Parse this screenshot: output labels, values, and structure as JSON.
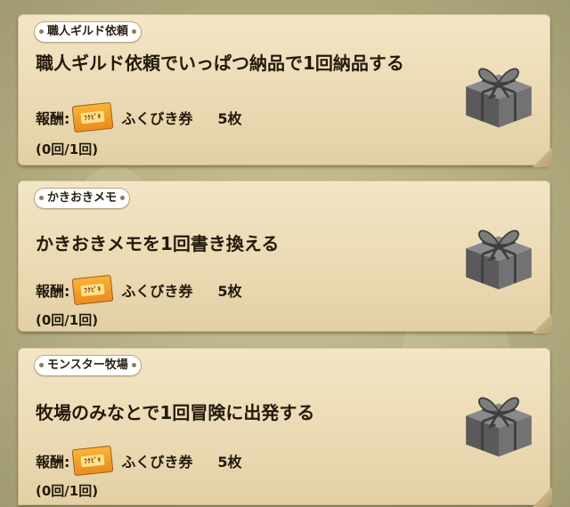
{
  "quests": [
    {
      "category": "職人ギルド依頼",
      "title": "職人ギルド依頼でいっぱつ納品で1回納品する",
      "reward_label": "報酬:",
      "reward_item": "ふくびき券",
      "reward_count": "5枚",
      "progress": "(0回/1回)",
      "icon": "gift-box-icon"
    },
    {
      "category": "かきおきメモ",
      "title": "かきおきメモを1回書き換える",
      "reward_label": "報酬:",
      "reward_item": "ふくびき券",
      "reward_count": "5枚",
      "progress": "(0回/1回)",
      "icon": "gift-box-icon"
    },
    {
      "category": "モンスター牧場",
      "title": "牧場のみなとで1回冒険に出発する",
      "reward_label": "報酬:",
      "reward_item": "ふくびき券",
      "reward_count": "5枚",
      "progress": "(0回/1回)",
      "icon": "gift-box-icon"
    }
  ],
  "colors": {
    "card": "#ecdcb6",
    "background": "#b4ae82",
    "ticket": "#f0a02c",
    "gift": "#6e6e6e"
  }
}
